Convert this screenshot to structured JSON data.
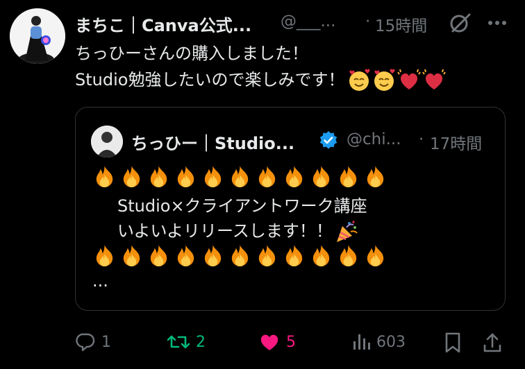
{
  "tweet": {
    "author_name": "まちこ｜Canva公式...",
    "author_handle": "@___...",
    "separator": "·",
    "time": "15時間",
    "text_line1": "ちっひーさんの購入しました！",
    "text_line2": "Studio勉強したいので楽しみです！",
    "emojis": [
      "smiling-face-with-hearts",
      "smiling-face-with-hearts",
      "beating-heart",
      "beating-heart"
    ]
  },
  "quote": {
    "author_name": "ちっひー｜Studio...",
    "verified": true,
    "author_handle": "@chi...",
    "separator": "·",
    "time": "17時間",
    "fire_count_row1": 11,
    "line1": "Studio×クライアントワーク講座",
    "line2": "いよいよリリースします！！",
    "fire_count_row2": 11,
    "ellipsis": "..."
  },
  "actions": {
    "reply_count": "1",
    "retweet_count": "2",
    "like_count": "5",
    "views_count": "603"
  },
  "colors": {
    "background": "#000000",
    "text": "#e7e9ea",
    "muted": "#71767b",
    "retweet_active": "#00ba7c",
    "like_active": "#f91880",
    "verified": "#1d9bf0",
    "border": "#2f3336"
  }
}
